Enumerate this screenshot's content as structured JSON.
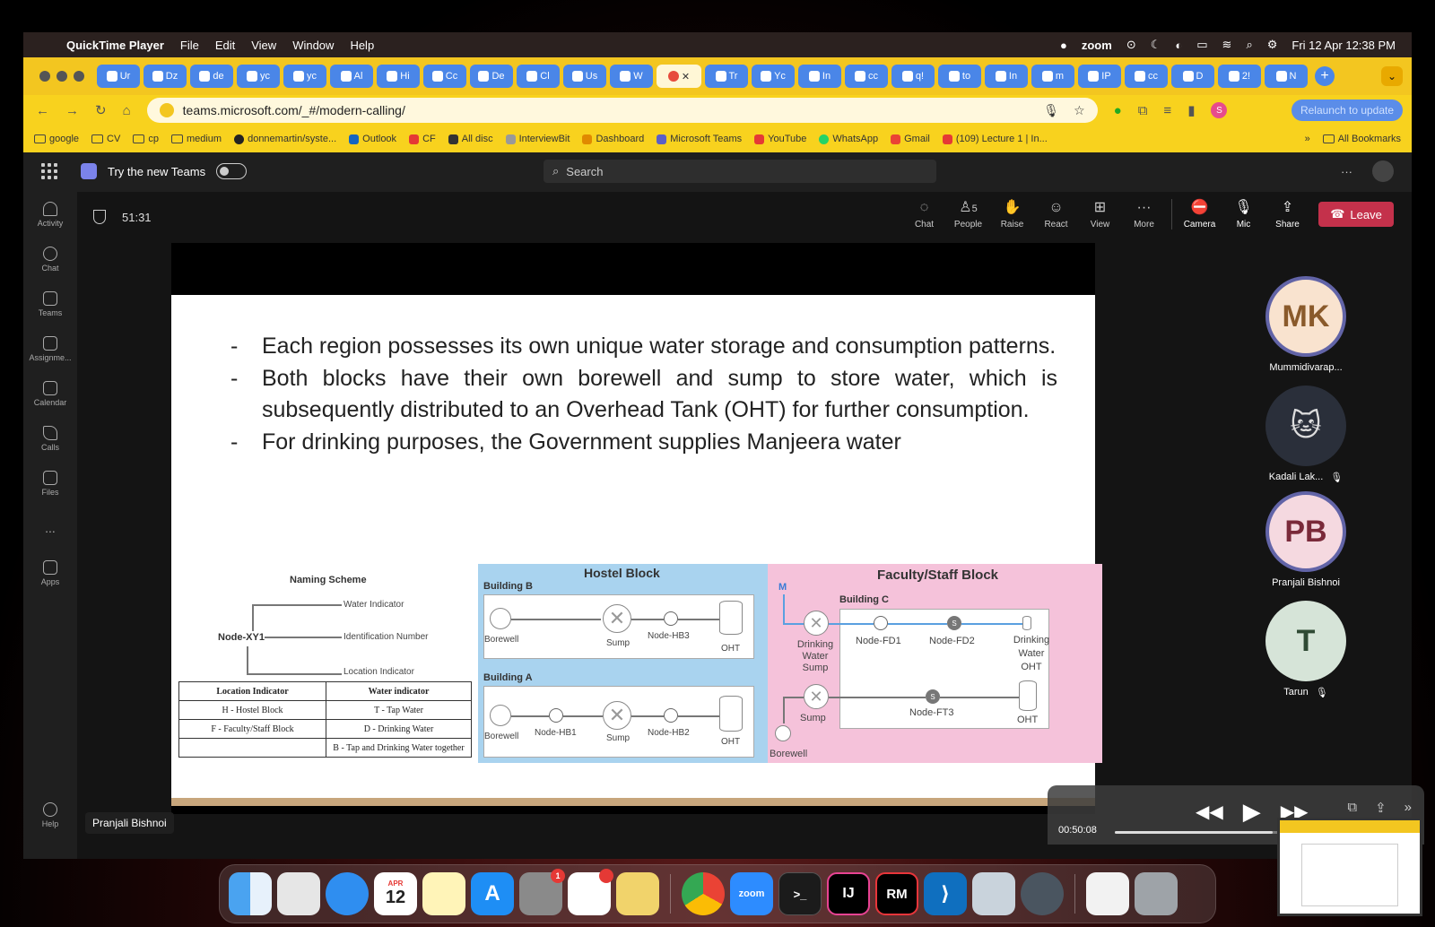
{
  "menubar": {
    "app_name": "QuickTime Player",
    "menus": [
      "File",
      "Edit",
      "View",
      "Window",
      "Help"
    ],
    "zoom_label": "zoom",
    "datetime": "Fri 12 Apr  12:38 PM"
  },
  "browser": {
    "tabs": [
      "Ur",
      "Dz",
      "de",
      "yc",
      "yc",
      "Al",
      "Hi",
      "Cc",
      "De",
      "Cl",
      "Us",
      "W",
      "",
      "Tr",
      "Yc",
      "In",
      "cc",
      "q!",
      "to",
      "In",
      "m",
      "IP",
      "cc",
      "D",
      "2!",
      "N"
    ],
    "url": "teams.microsoft.com/_#/modern-calling/",
    "relaunch_label": "Relaunch to update",
    "profile_initial": "S",
    "bookmarks": [
      "google",
      "CV",
      "cp",
      "medium",
      "donnemartin/syste...",
      "Outlook",
      "CF",
      "All disc",
      "InterviewBit",
      "Dashboard",
      "Microsoft Teams",
      "YouTube",
      "WhatsApp",
      "Gmail",
      "(109) Lecture 1 | In..."
    ],
    "all_bookmarks_label": "All Bookmarks"
  },
  "teams": {
    "try_new_label": "Try the new Teams",
    "search_placeholder": "Search",
    "rail": [
      "Activity",
      "Chat",
      "Teams",
      "Assignme...",
      "Calendar",
      "Calls",
      "Files",
      "...",
      "Apps"
    ],
    "help_label": "Help",
    "meeting_timer": "51:31",
    "controls": {
      "chat": "Chat",
      "people": "People",
      "people_count": "5",
      "raise": "Raise",
      "react": "React",
      "view": "View",
      "more": "More",
      "camera": "Camera",
      "mic": "Mic",
      "share": "Share",
      "leave": "Leave"
    },
    "presenter_name": "Pranjali Bishnoi",
    "participants": [
      {
        "initials": "MK",
        "name": "Mummidivarap...",
        "muted": false
      },
      {
        "initials": "",
        "name": "Kadali Lak...",
        "muted": true
      },
      {
        "initials": "PB",
        "name": "Pranjali Bishnoi",
        "muted": false
      },
      {
        "initials": "T",
        "name": "Tarun",
        "muted": true
      }
    ]
  },
  "slide": {
    "bullets": [
      "Each region possesses its own unique water storage and consumption patterns.",
      "Both blocks have their own borewell and sump to store water, which is subsequently distributed to an Overhead Tank (OHT) for further consumption.",
      "For drinking purposes, the Government supplies Manjeera water"
    ],
    "naming": {
      "title": "Naming Scheme",
      "node": "Node-XY1",
      "water_indicator": "Water Indicator",
      "identification": "Identification Number",
      "location": "Location Indicator",
      "table_headers": [
        "Location Indicator",
        "Water indicator"
      ],
      "table_rows": [
        [
          "H - Hostel Block",
          "T - Tap Water"
        ],
        [
          "F - Faculty/Staff Block",
          "D - Drinking Water"
        ],
        [
          "",
          "B - Tap and Drinking Water together"
        ]
      ]
    },
    "hostel": {
      "title": "Hostel Block",
      "building_b": "Building B",
      "building_a": "Building A",
      "borewell": "Borewell",
      "sump": "Sump",
      "oht": "OHT",
      "hb3": "Node-HB3",
      "hb1": "Node-HB1",
      "hb2": "Node-HB2"
    },
    "faculty": {
      "title": "Faculty/Staff Block",
      "m": "M",
      "building_c": "Building C",
      "dw_sump": "Drinking Water Sump",
      "fd1": "Node-FD1",
      "fd2": "Node-FD2",
      "dw_oht": "Drinking Water OHT",
      "sump": "Sump",
      "ft3": "Node-FT3",
      "oht": "OHT",
      "borewell": "Borewell",
      "s": "S"
    }
  },
  "quicktime": {
    "current_time": "00:50:08",
    "progress": 0.55
  },
  "dock": {
    "calendar_month": "APR",
    "calendar_day": "12",
    "settings_badge": "1",
    "zoom_label": "zoom",
    "intellij_label": "IJ",
    "rubymine_label": "RM",
    "apps": [
      "finder-icon",
      "launchpad-icon",
      "safari-icon",
      "calendar-icon",
      "notes-icon",
      "app-store-icon",
      "system-settings-icon",
      "slack-icon",
      "stickies-icon",
      "chrome-icon",
      "zoom-icon",
      "terminal-icon",
      "intellij-icon",
      "rubymine-icon",
      "vscode-icon",
      "preview-icon",
      "quicktime-icon",
      "document-icon",
      "trash-icon"
    ]
  },
  "colors": {
    "leave": "#c4314b",
    "chrome_yellow": "#f3c620",
    "hostel_bg": "#a9d3ef",
    "faculty_bg": "#f5c2da"
  }
}
